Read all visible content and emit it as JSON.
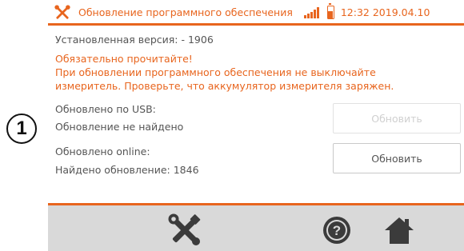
{
  "callout": {
    "number": "1"
  },
  "header": {
    "title": "Обновление программного обеспечения",
    "time": "12:32 2019.04.10",
    "icons": [
      "tools-icon",
      "signal-icon",
      "battery-icon"
    ],
    "accent_color": "#e8651e"
  },
  "main": {
    "installed_version": "Установленная версия: - 1906",
    "warning": {
      "line1": "Обязательно прочитайте!",
      "line2": "При обновлении программного обеспечения не выключайте",
      "line3": "измеритель. Проверьте, что аккумулятор измерителя заряжен."
    },
    "usb": {
      "label": "Обновлено по USB:",
      "status": "Обновление не найдено",
      "button_label": "Обновить",
      "button_enabled": false
    },
    "online": {
      "label": "Обновлено online:",
      "status": "Найдено обновление: 1846",
      "button_label": "Обновить",
      "button_enabled": true
    }
  },
  "footer": {
    "icons": [
      "tools-icon",
      "help-icon",
      "home-icon"
    ]
  }
}
